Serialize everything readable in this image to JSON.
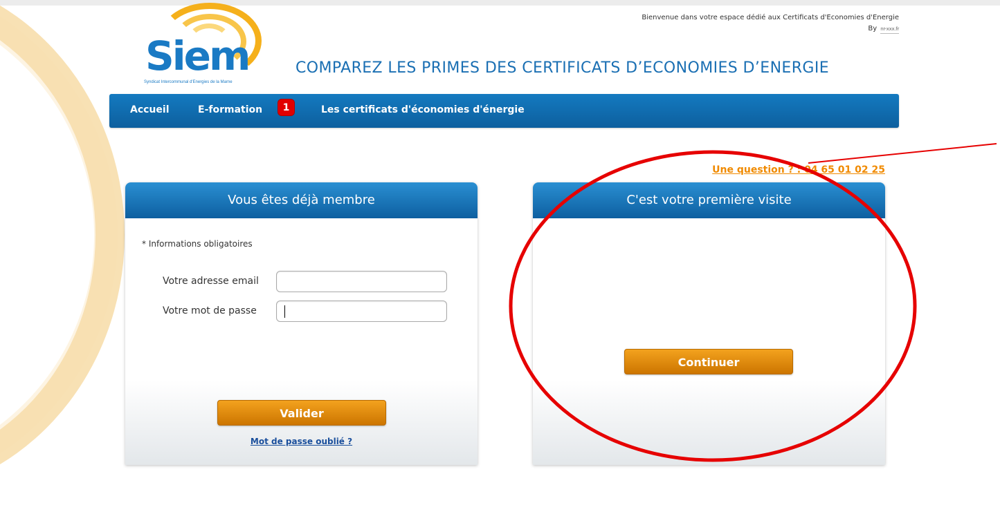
{
  "header": {
    "welcome_text": "Bienvenue dans votre espace dédié aux Certificats d'Economies d'Energie",
    "by_label": "By",
    "by_brand": "nr-xxx.fr",
    "logo_text": "Siem",
    "logo_subtitle": "Syndicat Intercommunal d'Energies de la Marne",
    "headline": "COMPAREZ LES PRIMES DES CERTIFICATS D’ECONOMIES D’ENERGIE"
  },
  "nav": {
    "items": [
      {
        "label": "Accueil"
      },
      {
        "label": "E-formation"
      },
      {
        "label": "Les certificats d'économies d'énergie"
      }
    ],
    "badge": "1"
  },
  "question_link": "Une question ? : 04 65 01 02 25",
  "login_panel": {
    "title": "Vous êtes déjà membre",
    "required_note": "* Informations obligatoires",
    "email_label": "Votre adresse email",
    "email_value": "",
    "password_label": "Votre mot de passe",
    "password_value": "",
    "submit_label": "Valider",
    "forgot_label": "Mot de passe oublié ?"
  },
  "first_visit_panel": {
    "title": "C'est votre première visite",
    "continue_label": "Continuer"
  },
  "colors": {
    "primary_blue": "#0d5f9e",
    "accent_orange": "#f08a00",
    "badge_red": "#e10000",
    "annotation_red": "#e60000"
  }
}
